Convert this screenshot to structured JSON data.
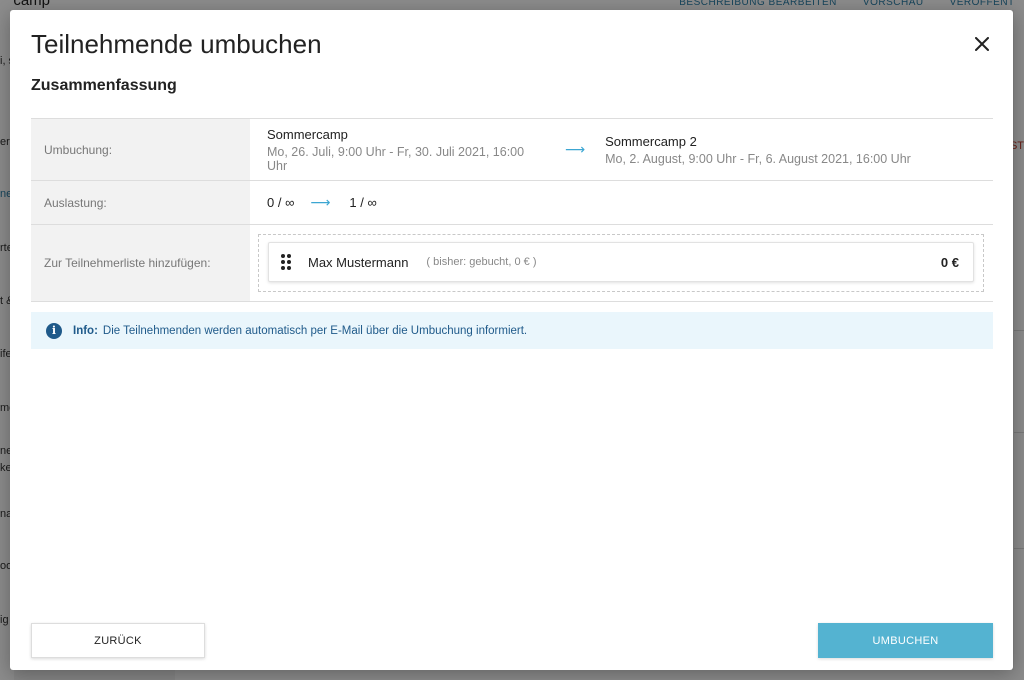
{
  "background": {
    "title": "ercamp",
    "actions": [
      "BESCHREIBUNG BEARBEITEN",
      "VORSCHAU",
      "VERÖFFENTLI"
    ],
    "left_fragments": [
      "i, s",
      "er",
      "ne",
      "rte",
      "t &",
      "ife",
      "me",
      "ne",
      "ke",
      "na",
      "oo",
      "ig"
    ],
    "right_fragment": "ST"
  },
  "modal": {
    "title": "Teilnehmende umbuchen",
    "subtitle": "Zusammenfassung"
  },
  "summary": {
    "booking": {
      "label": "Umbuchung:",
      "from_name": "Sommercamp",
      "from_dates": "Mo, 26. Juli, 9:00 Uhr - Fr, 30. Juli 2021, 16:00 Uhr",
      "to_name": "Sommercamp 2",
      "to_dates": "Mo, 2. August, 9:00 Uhr - Fr, 6. August 2021, 16:00 Uhr",
      "arrow": "⟶"
    },
    "capacity": {
      "label": "Auslastung:",
      "from": "0 / ∞",
      "to": "1 / ∞",
      "arrow": "⟶"
    },
    "add_to_list": {
      "label": "Zur Teilnehmerliste hinzufügen:",
      "participant_name": "Max Mustermann",
      "participant_previous": "( bisher: gebucht, 0 € )",
      "participant_price": "0 €"
    }
  },
  "info": {
    "icon": "i",
    "label": "Info:",
    "text": "Die Teilnehmenden werden automatisch per E-Mail über die Umbuchung informiert."
  },
  "buttons": {
    "back": "ZURÜCK",
    "submit": "UMBUCHEN"
  },
  "colors": {
    "accent": "#54b3d1",
    "arrow": "#3ca6d2",
    "info_bg": "#eaf6fc",
    "info_text": "#1f5a8a"
  }
}
